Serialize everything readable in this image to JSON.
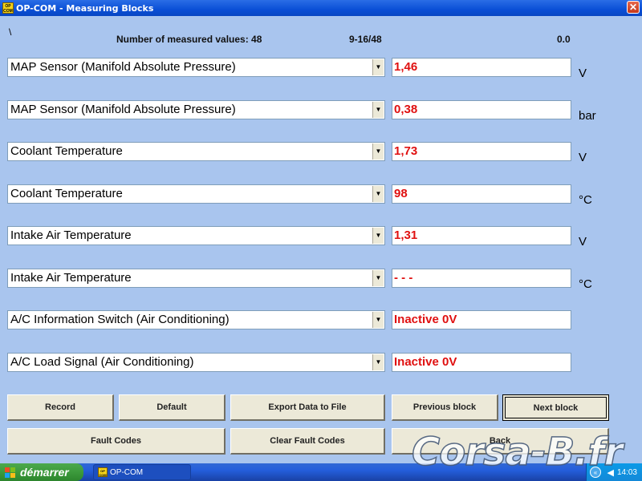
{
  "window": {
    "title": "OP-COM - Measuring Blocks",
    "icon_text": "OP COM",
    "close": "✕"
  },
  "header": {
    "marker": "\\",
    "count_text": "Number of measured values: 48",
    "range_text": "9-16/48",
    "time_text": "0.0"
  },
  "rows": [
    {
      "label": "MAP Sensor (Manifold Absolute Pressure)",
      "value": "1,46",
      "unit": "V"
    },
    {
      "label": "MAP Sensor (Manifold Absolute Pressure)",
      "value": "0,38",
      "unit": "bar"
    },
    {
      "label": "Coolant Temperature",
      "value": "1,73",
      "unit": "V"
    },
    {
      "label": "Coolant Temperature",
      "value": "98",
      "unit": "°C"
    },
    {
      "label": "Intake Air Temperature",
      "value": "1,31",
      "unit": "V"
    },
    {
      "label": "Intake Air Temperature",
      "value": "- - -",
      "unit": "°C"
    },
    {
      "label": "A/C Information Switch (Air Conditioning)",
      "value": "Inactive 0V",
      "unit": ""
    },
    {
      "label": "A/C Load Signal (Air Conditioning)",
      "value": "Inactive 0V",
      "unit": ""
    }
  ],
  "buttons": {
    "record": "Record",
    "default": "Default",
    "export": "Export Data to File",
    "previous": "Previous block",
    "next": "Next block",
    "fault_codes": "Fault Codes",
    "clear_fault_codes": "Clear Fault Codes",
    "back": "Back"
  },
  "taskbar": {
    "start": "démarrer",
    "task": "OP-COM",
    "clock": "14:03"
  },
  "watermark": "Corsa-B.fr",
  "colors": {
    "value_text": "#e01010",
    "background": "#a9c5ee",
    "titlebar": "#0a4fd6"
  },
  "icons": {
    "dropdown": "chevron-down-icon",
    "close": "close-icon",
    "windows_flag": "windows-logo-icon",
    "speaker": "speaker-icon"
  }
}
